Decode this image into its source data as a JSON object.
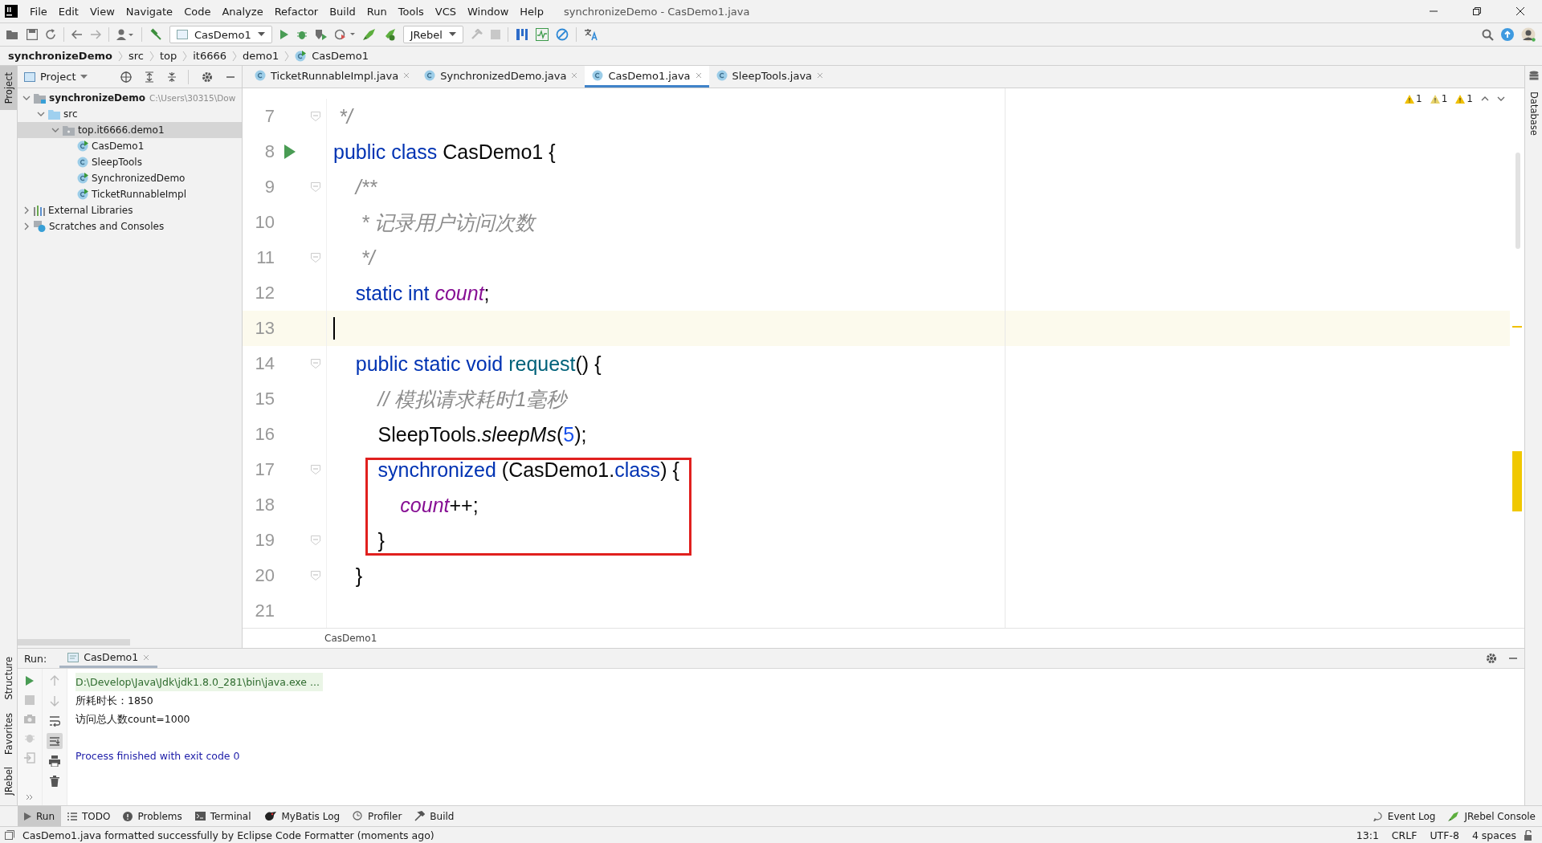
{
  "window": {
    "title": "synchronizeDemo - CasDemo1.java"
  },
  "menu": [
    "File",
    "Edit",
    "View",
    "Navigate",
    "Code",
    "Analyze",
    "Refactor",
    "Build",
    "Run",
    "Tools",
    "VCS",
    "Window",
    "Help"
  ],
  "toolbar": {
    "run_config": "CasDemo1",
    "jrebel": "JRebel"
  },
  "breadcrumb": [
    "synchronizeDemo",
    "src",
    "top",
    "it6666",
    "demo1",
    "CasDemo1"
  ],
  "side_strips": {
    "left_top": [
      {
        "label": "Project",
        "selected": true
      }
    ],
    "left_bottom": [
      {
        "label": "Structure",
        "selected": false
      },
      {
        "label": "Favorites",
        "selected": false
      },
      {
        "label": "JRebel",
        "selected": false
      }
    ],
    "right": [
      {
        "label": "Database",
        "selected": false
      }
    ]
  },
  "project": {
    "title": "Project",
    "tree": [
      {
        "label": "synchronizeDemo",
        "hint": "C:\\Users\\30315\\Dow",
        "kind": "project",
        "expanded": true,
        "selected": false,
        "children": [
          {
            "label": "src",
            "kind": "folder",
            "expanded": true,
            "selected": false,
            "children": [
              {
                "label": "top.it6666.demo1",
                "kind": "package",
                "expanded": true,
                "selected": true,
                "children": [
                  {
                    "label": "CasDemo1",
                    "kind": "class",
                    "runnable": true,
                    "selected": false
                  },
                  {
                    "label": "SleepTools",
                    "kind": "class",
                    "runnable": false,
                    "selected": false
                  },
                  {
                    "label": "SynchronizedDemo",
                    "kind": "class",
                    "runnable": true,
                    "selected": false
                  },
                  {
                    "label": "TicketRunnableImpl",
                    "kind": "class",
                    "runnable": true,
                    "selected": false
                  }
                ]
              }
            ]
          }
        ]
      },
      {
        "label": "External Libraries",
        "kind": "libraries",
        "expanded": false,
        "selected": false
      },
      {
        "label": "Scratches and Consoles",
        "kind": "scratches",
        "expanded": false,
        "selected": false
      }
    ]
  },
  "editor": {
    "tabs": [
      {
        "label": "TicketRunnableImpl.java",
        "selected": false
      },
      {
        "label": "SynchronizedDemo.java",
        "selected": false
      },
      {
        "label": "CasDemo1.java",
        "selected": true
      },
      {
        "label": "SleepTools.java",
        "selected": false
      }
    ],
    "warnings": [
      "1",
      "1",
      "1"
    ],
    "lines": [
      {
        "number": "7",
        "current": false,
        "run": false,
        "fold": true,
        "tokens": [
          {
            "kind": "comment",
            "text": " */"
          }
        ]
      },
      {
        "number": "8",
        "current": false,
        "run": true,
        "fold": false,
        "tokens": [
          {
            "kind": "keyword",
            "text": "public class "
          },
          {
            "kind": "plain",
            "text": "CasDemo1 {"
          }
        ]
      },
      {
        "number": "9",
        "current": false,
        "run": false,
        "fold": true,
        "tokens": [
          {
            "kind": "comment",
            "text": "    /**"
          }
        ]
      },
      {
        "number": "10",
        "current": false,
        "run": false,
        "fold": false,
        "tokens": [
          {
            "kind": "comment",
            "text": "     * 记录用户访问次数"
          }
        ]
      },
      {
        "number": "11",
        "current": false,
        "run": false,
        "fold": true,
        "tokens": [
          {
            "kind": "comment",
            "text": "     */"
          }
        ]
      },
      {
        "number": "12",
        "current": false,
        "run": false,
        "fold": false,
        "tokens": [
          {
            "kind": "keyword",
            "text": "    static int "
          },
          {
            "kind": "field",
            "text": "count"
          },
          {
            "kind": "plain",
            "text": ";"
          }
        ]
      },
      {
        "number": "13",
        "current": true,
        "run": false,
        "fold": false
      },
      {
        "number": "14",
        "current": false,
        "run": false,
        "fold": true,
        "tokens": [
          {
            "kind": "keyword",
            "text": "    public static void "
          },
          {
            "kind": "method",
            "text": "request"
          },
          {
            "kind": "plain",
            "text": "() {"
          }
        ]
      },
      {
        "number": "15",
        "current": false,
        "run": false,
        "fold": false,
        "tokens": [
          {
            "kind": "comment",
            "text": "        // 模拟请求耗时1毫秒"
          }
        ]
      },
      {
        "number": "16",
        "current": false,
        "run": false,
        "fold": false,
        "tokens": [
          {
            "kind": "plain",
            "text": "        SleepTools."
          },
          {
            "kind": "static",
            "text": "sleepMs"
          },
          {
            "kind": "plain",
            "text": "("
          },
          {
            "kind": "number",
            "text": "5"
          },
          {
            "kind": "plain",
            "text": ");"
          }
        ]
      },
      {
        "number": "17",
        "current": false,
        "run": false,
        "fold": true,
        "tokens": [
          {
            "kind": "keyword",
            "text": "        synchronized "
          },
          {
            "kind": "plain",
            "text": "(CasDemo1."
          },
          {
            "kind": "keyword",
            "text": "class"
          },
          {
            "kind": "plain",
            "text": ") {"
          }
        ]
      },
      {
        "number": "18",
        "current": false,
        "run": false,
        "fold": false,
        "tokens": [
          {
            "kind": "field",
            "text": "            count"
          },
          {
            "kind": "plain",
            "text": "++;"
          }
        ]
      },
      {
        "number": "19",
        "current": false,
        "run": false,
        "fold": true,
        "tokens": [
          {
            "kind": "plain",
            "text": "        }"
          }
        ]
      },
      {
        "number": "20",
        "current": false,
        "run": false,
        "fold": true,
        "tokens": [
          {
            "kind": "plain",
            "text": "    }"
          }
        ]
      },
      {
        "number": "21",
        "current": false,
        "run": false,
        "fold": false
      }
    ],
    "breadcrumb": "CasDemo1"
  },
  "run_panel": {
    "label": "Run:",
    "tab": "CasDemo1",
    "output": [
      {
        "kind": "command",
        "text": "D:\\Develop\\Java\\Jdk\\jdk1.8.0_281\\bin\\java.exe ..."
      },
      {
        "kind": "stdout",
        "text": "所耗时长：1850"
      },
      {
        "kind": "stdout",
        "text": "访问总人数count=1000"
      },
      {
        "kind": "system",
        "text": "Process finished with exit code 0"
      }
    ]
  },
  "tool_tabs": {
    "left": [
      {
        "label": "Run",
        "kind": "run",
        "selected": true
      },
      {
        "label": "TODO",
        "kind": "todo",
        "selected": false
      },
      {
        "label": "Problems",
        "kind": "problems",
        "selected": false
      },
      {
        "label": "Terminal",
        "kind": "terminal",
        "selected": false
      },
      {
        "label": "MyBatis Log",
        "kind": "log",
        "selected": false
      },
      {
        "label": "Profiler",
        "kind": "profiler",
        "selected": false
      },
      {
        "label": "Build",
        "kind": "build",
        "selected": false
      }
    ],
    "right": [
      {
        "label": "Event Log",
        "kind": "events"
      },
      {
        "label": "JRebel Console",
        "kind": "console"
      }
    ]
  },
  "status_bar": {
    "message": "CasDemo1.java formatted successfully by Eclipse Code Formatter (moments ago)",
    "items": [
      "13:1",
      "CRLF",
      "UTF-8",
      "4 spaces"
    ]
  }
}
